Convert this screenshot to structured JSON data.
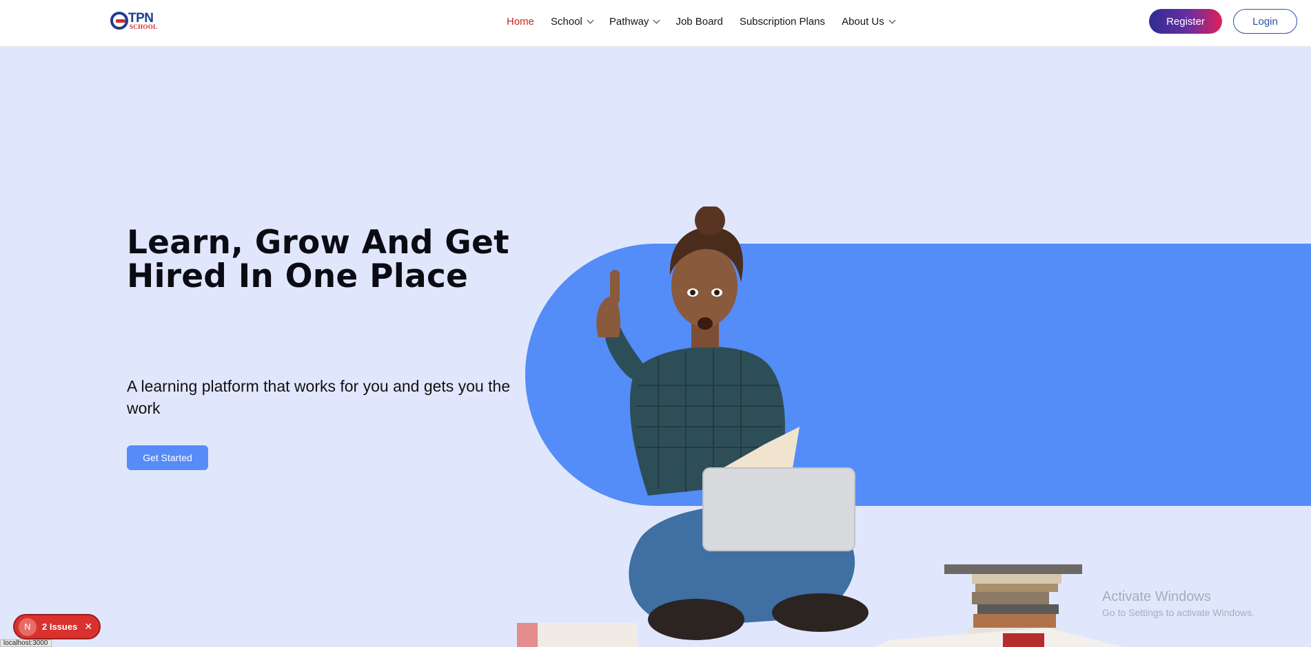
{
  "header": {
    "logo": {
      "brand": "TPN",
      "sub": "SCHOOL"
    },
    "nav": [
      {
        "label": "Home",
        "active": true,
        "dropdown": false
      },
      {
        "label": "School",
        "active": false,
        "dropdown": true
      },
      {
        "label": "Pathway",
        "active": false,
        "dropdown": true
      },
      {
        "label": "Job Board",
        "active": false,
        "dropdown": false
      },
      {
        "label": "Subscription Plans",
        "active": false,
        "dropdown": false
      },
      {
        "label": "About Us",
        "active": false,
        "dropdown": true
      }
    ],
    "register_label": "Register",
    "login_label": "Login"
  },
  "hero": {
    "title": "Learn, Grow And Get Hired In One Place",
    "subtitle": "A learning platform that works for you and gets you the work",
    "cta_label": "Get Started"
  },
  "overlay": {
    "activate_title": "Activate Windows",
    "activate_sub": "Go to Settings to activate Windows."
  },
  "dev": {
    "issues_label": "2 Issues",
    "status_url": "localhost:3000"
  },
  "colors": {
    "page_bg": "#e0e7fd",
    "accent_blue": "#548cf8",
    "nav_active": "#c4231f",
    "brand_navy": "#1e3d8f"
  }
}
